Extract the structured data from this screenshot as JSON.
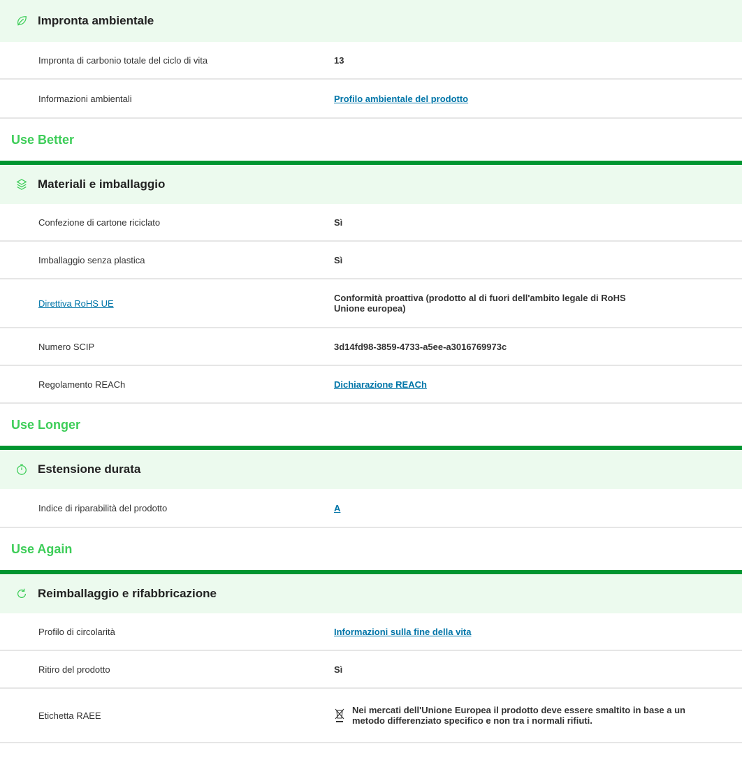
{
  "environmental": {
    "title": "Impronta ambientale",
    "icon": "leaf-icon",
    "rows": [
      {
        "label": "Impronta di carbonio totale del ciclo di vita",
        "value": "13"
      },
      {
        "label": "Informazioni ambientali",
        "value": "Profilo ambientale del prodotto"
      }
    ]
  },
  "use_better": {
    "heading": "Use Better",
    "category": "Materiali e imballaggio",
    "icon": "layers-icon",
    "rows": [
      {
        "label": "Confezione di cartone riciclato",
        "value": "Sì"
      },
      {
        "label": "Imballaggio senza plastica",
        "value": "Sì"
      },
      {
        "label": "Direttiva RoHS UE",
        "value": "Conformità proattiva (prodotto al di fuori dell'ambito legale di RoHS Unione europea)"
      },
      {
        "label": "Numero SCIP",
        "value": "3d14fd98-3859-4733-a5ee-a3016769973c"
      },
      {
        "label": "Regolamento REACh",
        "value": "Dichiarazione REACh"
      }
    ]
  },
  "use_longer": {
    "heading": "Use Longer",
    "category": "Estensione durata",
    "icon": "timer-icon",
    "rows": [
      {
        "label": "Indice di riparabilità del prodotto",
        "value": "A"
      }
    ]
  },
  "use_again": {
    "heading": "Use Again",
    "category": "Reimballaggio e rifabbricazione",
    "icon": "refresh-icon",
    "rows": [
      {
        "label": "Profilo di circolarità",
        "value": "Informazioni sulla fine della vita"
      },
      {
        "label": "Ritiro del prodotto",
        "value": "Sì"
      },
      {
        "label": "Etichetta RAEE",
        "value": "Nei mercati dell'Unione Europea il prodotto deve essere smaltito in base a un metodo differenziato specifico e non tra i normali rifiuti."
      }
    ]
  },
  "colors": {
    "accent_green": "#3dcd58",
    "bar_green": "#009530",
    "category_bg": "#ecfaee",
    "link_blue": "#0075a8"
  }
}
